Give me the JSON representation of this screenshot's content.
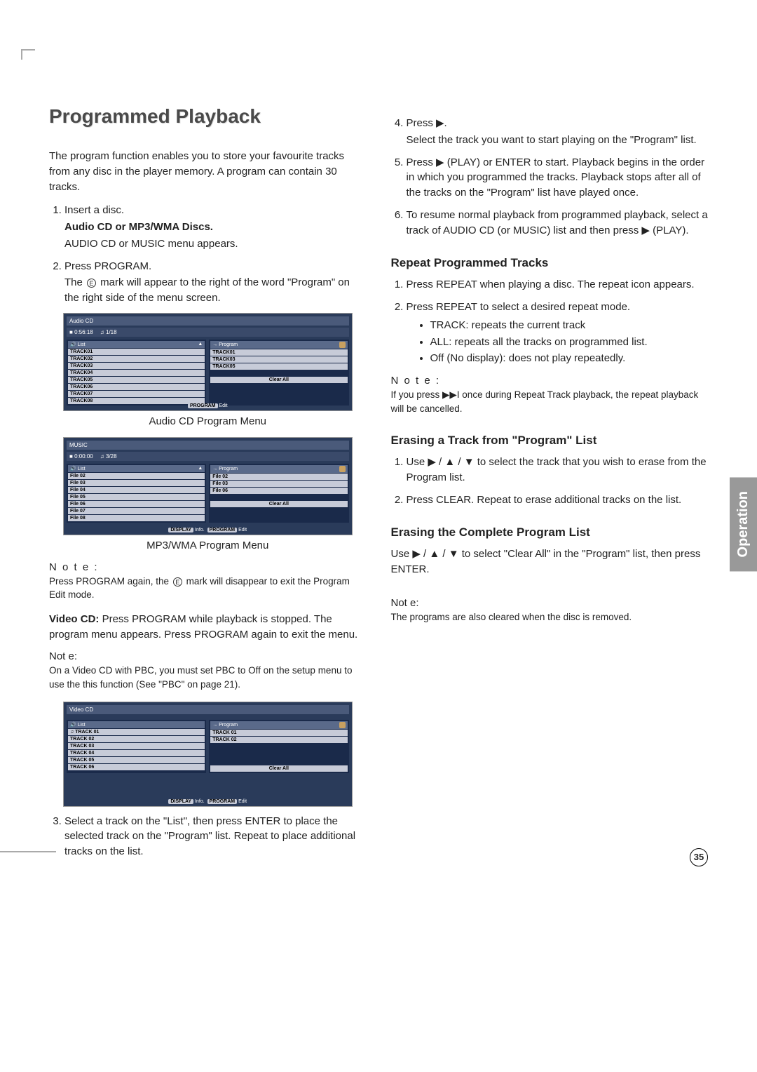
{
  "page_number": "35",
  "side_tab": "Operation",
  "title": "Programmed Playback",
  "intro": "The program function enables you to store your favourite tracks from any disc in the player memory. A program can contain 30 tracks.",
  "left_list": {
    "item1": {
      "line1": "Insert a disc.",
      "line2": "Audio CD or MP3/WMA Discs.",
      "line3": "AUDIO CD or MUSIC menu appears."
    },
    "item2": {
      "line1": "Press PROGRAM.",
      "line2a": "The ",
      "mark": "E",
      "line2b": " mark will appear to the right of the word \"Program\" on the right side of the menu screen."
    },
    "item3": "Select a track on the \"List\", then press ENTER to place the selected track on the \"Program\" list. Repeat to place additional tracks on the list."
  },
  "caption1": "Audio CD Program Menu",
  "caption2": "MP3/WMA Program Menu",
  "left_note1_label": "N o t e :",
  "left_note1_a": "Press PROGRAM again, the ",
  "left_note1_mark": "E",
  "left_note1_b": " mark will disappear to exit the Program Edit mode.",
  "left_videocd": "Video CD: Press PROGRAM while playback is stopped. The program menu appears. Press PROGRAM again to exit the menu.",
  "left_note2_label": "Not e:",
  "left_note2_text": "On a Video CD with PBC, you must set PBC to Off on the setup menu to use the this function (See \"PBC\" on page 21).",
  "right_list": {
    "item4": {
      "line1": "Press ▶.",
      "line2": "Select the track you want to start playing on the \"Program\" list."
    },
    "item5": "Press ▶ (PLAY) or ENTER to start. Playback begins in the order in which you programmed the tracks. Playback stops after all of the tracks on the \"Program\" list have played once.",
    "item6": "To resume normal playback from programmed playback, select a track of AUDIO CD (or MUSIC) list and then press ▶ (PLAY)."
  },
  "repeat": {
    "heading": "Repeat Programmed Tracks",
    "item1": "Press REPEAT when playing a disc. The repeat icon appears.",
    "item2": "Press REPEAT to select a desired repeat mode.",
    "b1": "TRACK: repeats the current track",
    "b2": "ALL: repeats all the tracks on programmed list.",
    "b3": "Off (No display): does not play repeatedly.",
    "note_label": "N o t e :",
    "note_text": "If you press ▶▶I once during Repeat Track playback, the repeat playback will be cancelled."
  },
  "erase_track": {
    "heading": "Erasing a Track from \"Program\" List",
    "item1": "Use ▶ / ▲ / ▼ to select the track that you wish to erase from the Program list.",
    "item2": "Press CLEAR. Repeat to erase additional tracks on the list."
  },
  "erase_all": {
    "heading": "Erasing the Complete Program List",
    "text": "Use ▶ / ▲ / ▼ to select \"Clear All\" in the \"Program\" list, then press ENTER.",
    "note_label": "Not e:",
    "note_text": "The programs are also cleared when the disc is removed."
  },
  "menu_audio": {
    "header": "Audio CD",
    "time": "0:56:18",
    "counter": "1/18",
    "list_label": "List",
    "program_label": "Program",
    "list": [
      "TRACK01",
      "TRACK02",
      "TRACK03",
      "TRACK04",
      "TRACK05",
      "TRACK06",
      "TRACK07",
      "TRACK08"
    ],
    "program": [
      "TRACK01",
      "TRACK03",
      "TRACK05"
    ],
    "clear": "Clear All",
    "footer_btn": "PROGRAM",
    "footer_txt": "Edit"
  },
  "menu_music": {
    "header": "MUSIC",
    "time": "0:00:00",
    "counter": "3/28",
    "list_label": "List",
    "program_label": "Program",
    "list": [
      "File 02",
      "File 03",
      "File 04",
      "File 05",
      "File 06",
      "File 07",
      "File 08"
    ],
    "program": [
      "File 02",
      "File 03",
      "File 06"
    ],
    "clear": "Clear All",
    "footer_btn1": "DISPLAY",
    "footer_txt1": "Info.",
    "footer_btn2": "PROGRAM",
    "footer_txt2": "Edit"
  },
  "menu_vcd": {
    "header": "Video CD",
    "list_label": "List",
    "program_label": "Program",
    "list": [
      "TRACK 01",
      "TRACK 02",
      "TRACK 03",
      "TRACK 04",
      "TRACK 05",
      "TRACK 06"
    ],
    "program": [
      "TRACK 01",
      "TRACK 02"
    ],
    "clear": "Clear All",
    "footer_btn1": "DISPLAY",
    "footer_txt1": "Info.",
    "footer_btn2": "PROGRAM",
    "footer_txt2": "Edit"
  }
}
